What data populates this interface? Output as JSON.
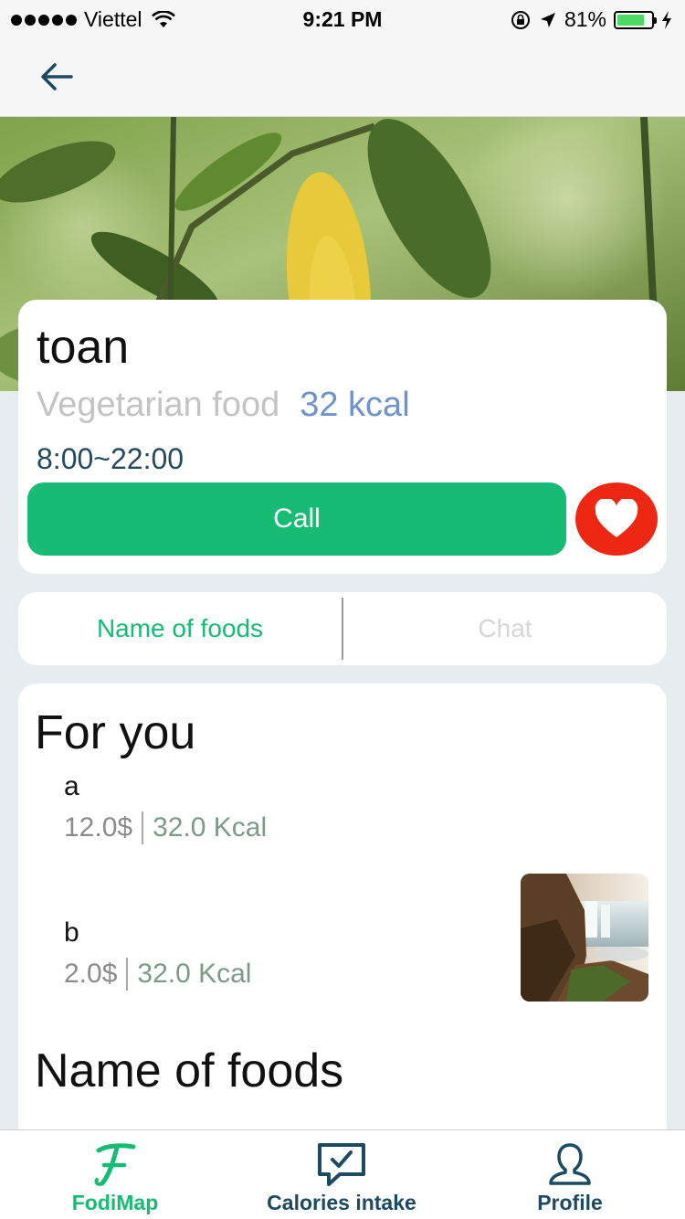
{
  "status_bar": {
    "carrier": "Viettel",
    "time": "9:21 PM",
    "battery": "81%",
    "battery_level": 0.81
  },
  "nav": {
    "back_icon": "arrow-left-icon"
  },
  "restaurant": {
    "name": "toan",
    "category": "Vegetarian food",
    "kcal": "32 kcal",
    "hours": "8:00~22:00",
    "call_label": "Call",
    "favorite_icon": "heart-icon"
  },
  "tabs": [
    {
      "label": "Name of foods",
      "active": true
    },
    {
      "label": "Chat",
      "active": false
    }
  ],
  "sections": {
    "for_you_title": "For you",
    "name_of_foods_title": "Name of foods"
  },
  "foods": [
    {
      "name": "a",
      "price": "12.0$",
      "kcal": "32.0 Kcal"
    },
    {
      "name": "b",
      "price": "2.0$",
      "kcal": "32.0 Kcal"
    }
  ],
  "tab_bar": [
    {
      "label": "FodiMap",
      "icon": "fodimap-logo-icon"
    },
    {
      "label": "Calories intake",
      "icon": "chat-check-icon"
    },
    {
      "label": "Profile",
      "icon": "person-icon"
    }
  ],
  "colors": {
    "accent": "#16bb74",
    "favorite": "#ee2713",
    "kcal": "#6d93c9",
    "hours": "#234a5e",
    "background": "#e6ecef"
  }
}
